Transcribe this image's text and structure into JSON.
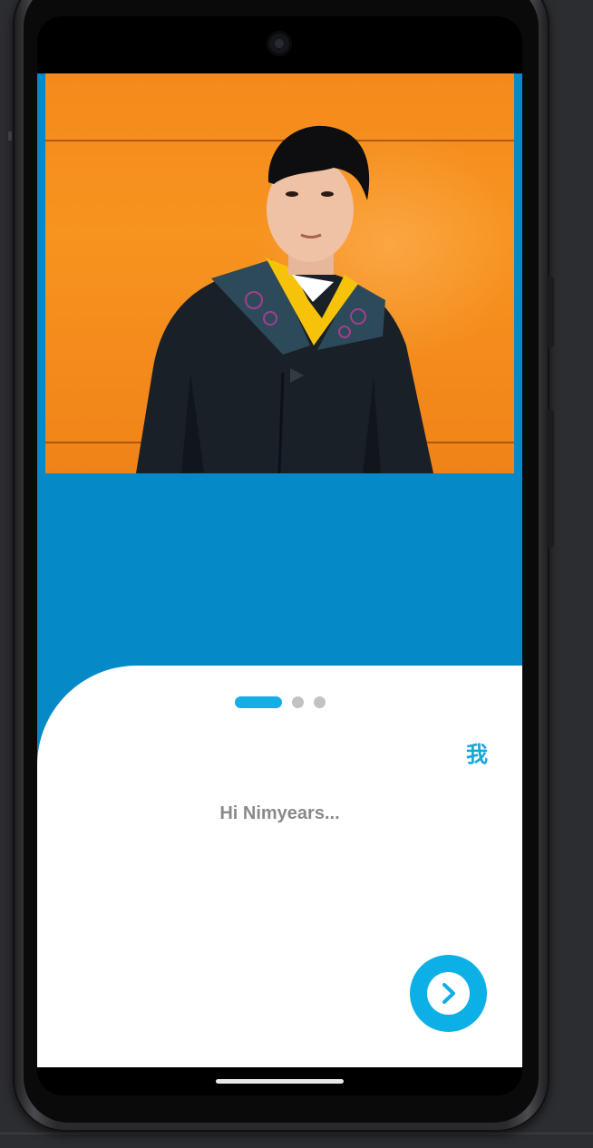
{
  "onboarding": {
    "photo_alt": "Graduate in academic gown",
    "pager": {
      "page_count": 3,
      "active_index": 0
    },
    "language_toggle": "我",
    "greeting": "Hi Nimyears...",
    "next_button_icon": "chevron-right-icon"
  },
  "colors": {
    "app_background": "#0589c7",
    "accent": "#13aee3",
    "greeting_text": "#8a8a8a",
    "inactive_dot": "#c2c2c2"
  }
}
